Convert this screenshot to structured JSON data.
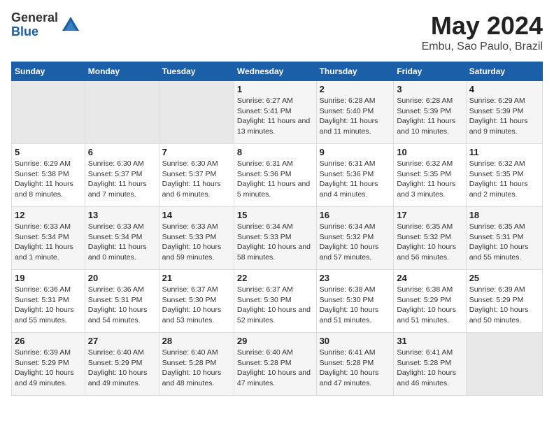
{
  "logo": {
    "general": "General",
    "blue": "Blue"
  },
  "title": "May 2024",
  "subtitle": "Embu, Sao Paulo, Brazil",
  "weekdays": [
    "Sunday",
    "Monday",
    "Tuesday",
    "Wednesday",
    "Thursday",
    "Friday",
    "Saturday"
  ],
  "weeks": [
    [
      {
        "day": "",
        "empty": true
      },
      {
        "day": "",
        "empty": true
      },
      {
        "day": "",
        "empty": true
      },
      {
        "day": "1",
        "sunrise": "Sunrise: 6:27 AM",
        "sunset": "Sunset: 5:41 PM",
        "daylight": "Daylight: 11 hours and 13 minutes."
      },
      {
        "day": "2",
        "sunrise": "Sunrise: 6:28 AM",
        "sunset": "Sunset: 5:40 PM",
        "daylight": "Daylight: 11 hours and 11 minutes."
      },
      {
        "day": "3",
        "sunrise": "Sunrise: 6:28 AM",
        "sunset": "Sunset: 5:39 PM",
        "daylight": "Daylight: 11 hours and 10 minutes."
      },
      {
        "day": "4",
        "sunrise": "Sunrise: 6:29 AM",
        "sunset": "Sunset: 5:39 PM",
        "daylight": "Daylight: 11 hours and 9 minutes."
      }
    ],
    [
      {
        "day": "5",
        "sunrise": "Sunrise: 6:29 AM",
        "sunset": "Sunset: 5:38 PM",
        "daylight": "Daylight: 11 hours and 8 minutes."
      },
      {
        "day": "6",
        "sunrise": "Sunrise: 6:30 AM",
        "sunset": "Sunset: 5:37 PM",
        "daylight": "Daylight: 11 hours and 7 minutes."
      },
      {
        "day": "7",
        "sunrise": "Sunrise: 6:30 AM",
        "sunset": "Sunset: 5:37 PM",
        "daylight": "Daylight: 11 hours and 6 minutes."
      },
      {
        "day": "8",
        "sunrise": "Sunrise: 6:31 AM",
        "sunset": "Sunset: 5:36 PM",
        "daylight": "Daylight: 11 hours and 5 minutes."
      },
      {
        "day": "9",
        "sunrise": "Sunrise: 6:31 AM",
        "sunset": "Sunset: 5:36 PM",
        "daylight": "Daylight: 11 hours and 4 minutes."
      },
      {
        "day": "10",
        "sunrise": "Sunrise: 6:32 AM",
        "sunset": "Sunset: 5:35 PM",
        "daylight": "Daylight: 11 hours and 3 minutes."
      },
      {
        "day": "11",
        "sunrise": "Sunrise: 6:32 AM",
        "sunset": "Sunset: 5:35 PM",
        "daylight": "Daylight: 11 hours and 2 minutes."
      }
    ],
    [
      {
        "day": "12",
        "sunrise": "Sunrise: 6:33 AM",
        "sunset": "Sunset: 5:34 PM",
        "daylight": "Daylight: 11 hours and 1 minute."
      },
      {
        "day": "13",
        "sunrise": "Sunrise: 6:33 AM",
        "sunset": "Sunset: 5:34 PM",
        "daylight": "Daylight: 11 hours and 0 minutes."
      },
      {
        "day": "14",
        "sunrise": "Sunrise: 6:33 AM",
        "sunset": "Sunset: 5:33 PM",
        "daylight": "Daylight: 10 hours and 59 minutes."
      },
      {
        "day": "15",
        "sunrise": "Sunrise: 6:34 AM",
        "sunset": "Sunset: 5:33 PM",
        "daylight": "Daylight: 10 hours and 58 minutes."
      },
      {
        "day": "16",
        "sunrise": "Sunrise: 6:34 AM",
        "sunset": "Sunset: 5:32 PM",
        "daylight": "Daylight: 10 hours and 57 minutes."
      },
      {
        "day": "17",
        "sunrise": "Sunrise: 6:35 AM",
        "sunset": "Sunset: 5:32 PM",
        "daylight": "Daylight: 10 hours and 56 minutes."
      },
      {
        "day": "18",
        "sunrise": "Sunrise: 6:35 AM",
        "sunset": "Sunset: 5:31 PM",
        "daylight": "Daylight: 10 hours and 55 minutes."
      }
    ],
    [
      {
        "day": "19",
        "sunrise": "Sunrise: 6:36 AM",
        "sunset": "Sunset: 5:31 PM",
        "daylight": "Daylight: 10 hours and 55 minutes."
      },
      {
        "day": "20",
        "sunrise": "Sunrise: 6:36 AM",
        "sunset": "Sunset: 5:31 PM",
        "daylight": "Daylight: 10 hours and 54 minutes."
      },
      {
        "day": "21",
        "sunrise": "Sunrise: 6:37 AM",
        "sunset": "Sunset: 5:30 PM",
        "daylight": "Daylight: 10 hours and 53 minutes."
      },
      {
        "day": "22",
        "sunrise": "Sunrise: 6:37 AM",
        "sunset": "Sunset: 5:30 PM",
        "daylight": "Daylight: 10 hours and 52 minutes."
      },
      {
        "day": "23",
        "sunrise": "Sunrise: 6:38 AM",
        "sunset": "Sunset: 5:30 PM",
        "daylight": "Daylight: 10 hours and 51 minutes."
      },
      {
        "day": "24",
        "sunrise": "Sunrise: 6:38 AM",
        "sunset": "Sunset: 5:29 PM",
        "daylight": "Daylight: 10 hours and 51 minutes."
      },
      {
        "day": "25",
        "sunrise": "Sunrise: 6:39 AM",
        "sunset": "Sunset: 5:29 PM",
        "daylight": "Daylight: 10 hours and 50 minutes."
      }
    ],
    [
      {
        "day": "26",
        "sunrise": "Sunrise: 6:39 AM",
        "sunset": "Sunset: 5:29 PM",
        "daylight": "Daylight: 10 hours and 49 minutes."
      },
      {
        "day": "27",
        "sunrise": "Sunrise: 6:40 AM",
        "sunset": "Sunset: 5:29 PM",
        "daylight": "Daylight: 10 hours and 49 minutes."
      },
      {
        "day": "28",
        "sunrise": "Sunrise: 6:40 AM",
        "sunset": "Sunset: 5:28 PM",
        "daylight": "Daylight: 10 hours and 48 minutes."
      },
      {
        "day": "29",
        "sunrise": "Sunrise: 6:40 AM",
        "sunset": "Sunset: 5:28 PM",
        "daylight": "Daylight: 10 hours and 47 minutes."
      },
      {
        "day": "30",
        "sunrise": "Sunrise: 6:41 AM",
        "sunset": "Sunset: 5:28 PM",
        "daylight": "Daylight: 10 hours and 47 minutes."
      },
      {
        "day": "31",
        "sunrise": "Sunrise: 6:41 AM",
        "sunset": "Sunset: 5:28 PM",
        "daylight": "Daylight: 10 hours and 46 minutes."
      },
      {
        "day": "",
        "empty": true
      }
    ]
  ]
}
